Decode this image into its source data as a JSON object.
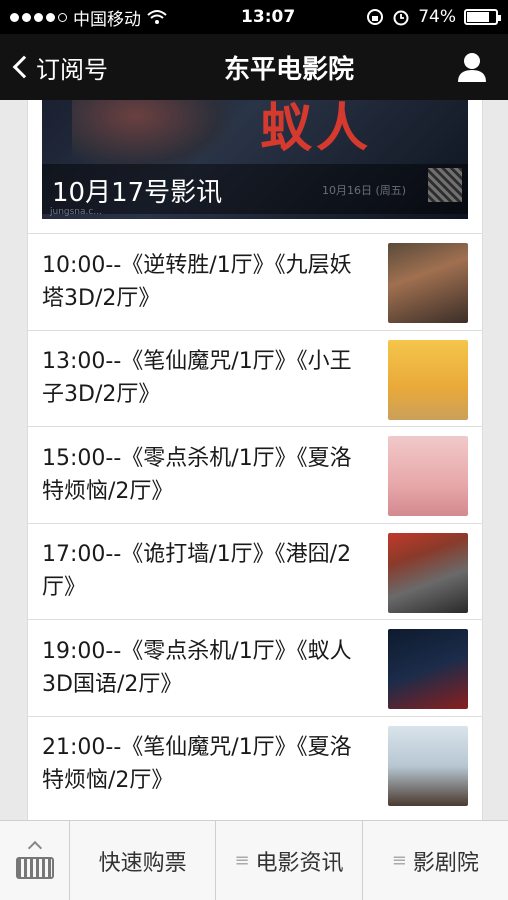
{
  "status_bar": {
    "carrier": "中国移动",
    "time": "13:07",
    "battery": "74%",
    "battery_level": 0.74
  },
  "nav": {
    "back_label": "订阅号",
    "title": "东平电影院"
  },
  "banner": {
    "title_art": "蚁人",
    "date_art": "10月16日 (周五)",
    "caption": "10月17号影讯",
    "watermark": "jungsna.c..."
  },
  "schedule": [
    {
      "text": "10:00--《逆转胜/1厅》《九层妖塔3D/2厅》"
    },
    {
      "text": "13:00--《笔仙魔咒/1厅》《小王子3D/2厅》"
    },
    {
      "text": "15:00--《零点杀机/1厅》《夏洛特烦恼/2厅》"
    },
    {
      "text": "17:00--《诡打墙/1厅》《港囧/2厅》"
    },
    {
      "text": "19:00--《零点杀机/1厅》《蚁人3D国语/2厅》"
    },
    {
      "text": "21:00--《笔仙魔咒/1厅》《夏洛特烦恼/2厅》"
    }
  ],
  "tabbar": {
    "tab1": "快速购票",
    "tab2": "电影资讯",
    "tab3": "影剧院"
  }
}
